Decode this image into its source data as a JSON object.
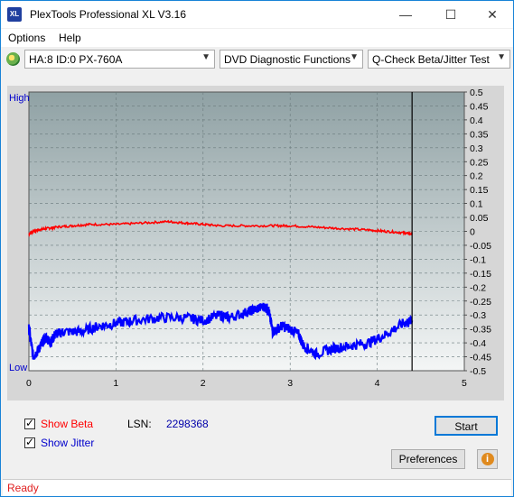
{
  "window": {
    "title": "PlexTools Professional XL V3.16",
    "app_icon_text": "XL",
    "minimize": "—",
    "maximize": "☐",
    "close": "✕"
  },
  "menu": {
    "options": "Options",
    "help": "Help"
  },
  "toolbar": {
    "drive": "HA:8 ID:0  PX-760A",
    "function": "DVD Diagnostic Functions",
    "test": "Q-Check Beta/Jitter Test"
  },
  "chart_data": {
    "type": "line",
    "left_label_high": "High",
    "left_label_low": "Low",
    "x_ticks": [
      "0",
      "1",
      "2",
      "3",
      "4",
      "5"
    ],
    "xlim": [
      0,
      5
    ],
    "y_right_ticks": [
      "0.5",
      "0.45",
      "0.4",
      "0.35",
      "0.3",
      "0.25",
      "0.2",
      "0.15",
      "0.1",
      "0.05",
      "0",
      "-0.05",
      "-0.1",
      "-0.15",
      "-0.2",
      "-0.25",
      "-0.3",
      "-0.35",
      "-0.4",
      "-0.45",
      "-0.5"
    ],
    "ylim": [
      -0.5,
      0.5
    ],
    "grid": true,
    "end_marker_x": 4.4,
    "series": [
      {
        "name": "Beta",
        "color": "#ff0000",
        "x": [
          0,
          0.05,
          0.1,
          0.2,
          0.3,
          0.5,
          0.7,
          1.0,
          1.3,
          1.6,
          1.8,
          2.0,
          2.2,
          2.5,
          2.8,
          3.0,
          3.3,
          3.6,
          3.9,
          4.1,
          4.3,
          4.4
        ],
        "y": [
          -0.01,
          0.0,
          0.005,
          0.01,
          0.015,
          0.02,
          0.025,
          0.025,
          0.03,
          0.035,
          0.03,
          0.025,
          0.02,
          0.02,
          0.02,
          0.02,
          0.015,
          0.01,
          0.005,
          0.0,
          -0.005,
          -0.01
        ]
      },
      {
        "name": "Jitter",
        "color": "#0000ff",
        "x": [
          0,
          0.05,
          0.1,
          0.15,
          0.2,
          0.25,
          0.3,
          0.4,
          0.6,
          0.8,
          1.0,
          1.2,
          1.5,
          1.8,
          2.0,
          2.2,
          2.3,
          2.5,
          2.6,
          2.7,
          2.75,
          2.8,
          2.9,
          3.0,
          3.1,
          3.15,
          3.3,
          3.5,
          3.7,
          3.9,
          4.1,
          4.3,
          4.4
        ],
        "y": [
          -0.35,
          -0.45,
          -0.43,
          -0.4,
          -0.38,
          -0.4,
          -0.37,
          -0.36,
          -0.36,
          -0.34,
          -0.33,
          -0.32,
          -0.31,
          -0.31,
          -0.32,
          -0.3,
          -0.31,
          -0.29,
          -0.28,
          -0.27,
          -0.28,
          -0.36,
          -0.34,
          -0.35,
          -0.37,
          -0.41,
          -0.44,
          -0.42,
          -0.41,
          -0.4,
          -0.37,
          -0.33,
          -0.32
        ]
      }
    ]
  },
  "options": {
    "show_beta": "Show Beta",
    "show_jitter": "Show Jitter",
    "lsn_label": "LSN:",
    "lsn_value": "2298368"
  },
  "buttons": {
    "start": "Start",
    "preferences": "Preferences",
    "info": "i"
  },
  "status": {
    "text": "Ready"
  },
  "colors": {
    "accent": "#1883d7",
    "beta": "#ff0000",
    "jitter": "#0000ff",
    "status": "#e02020"
  }
}
